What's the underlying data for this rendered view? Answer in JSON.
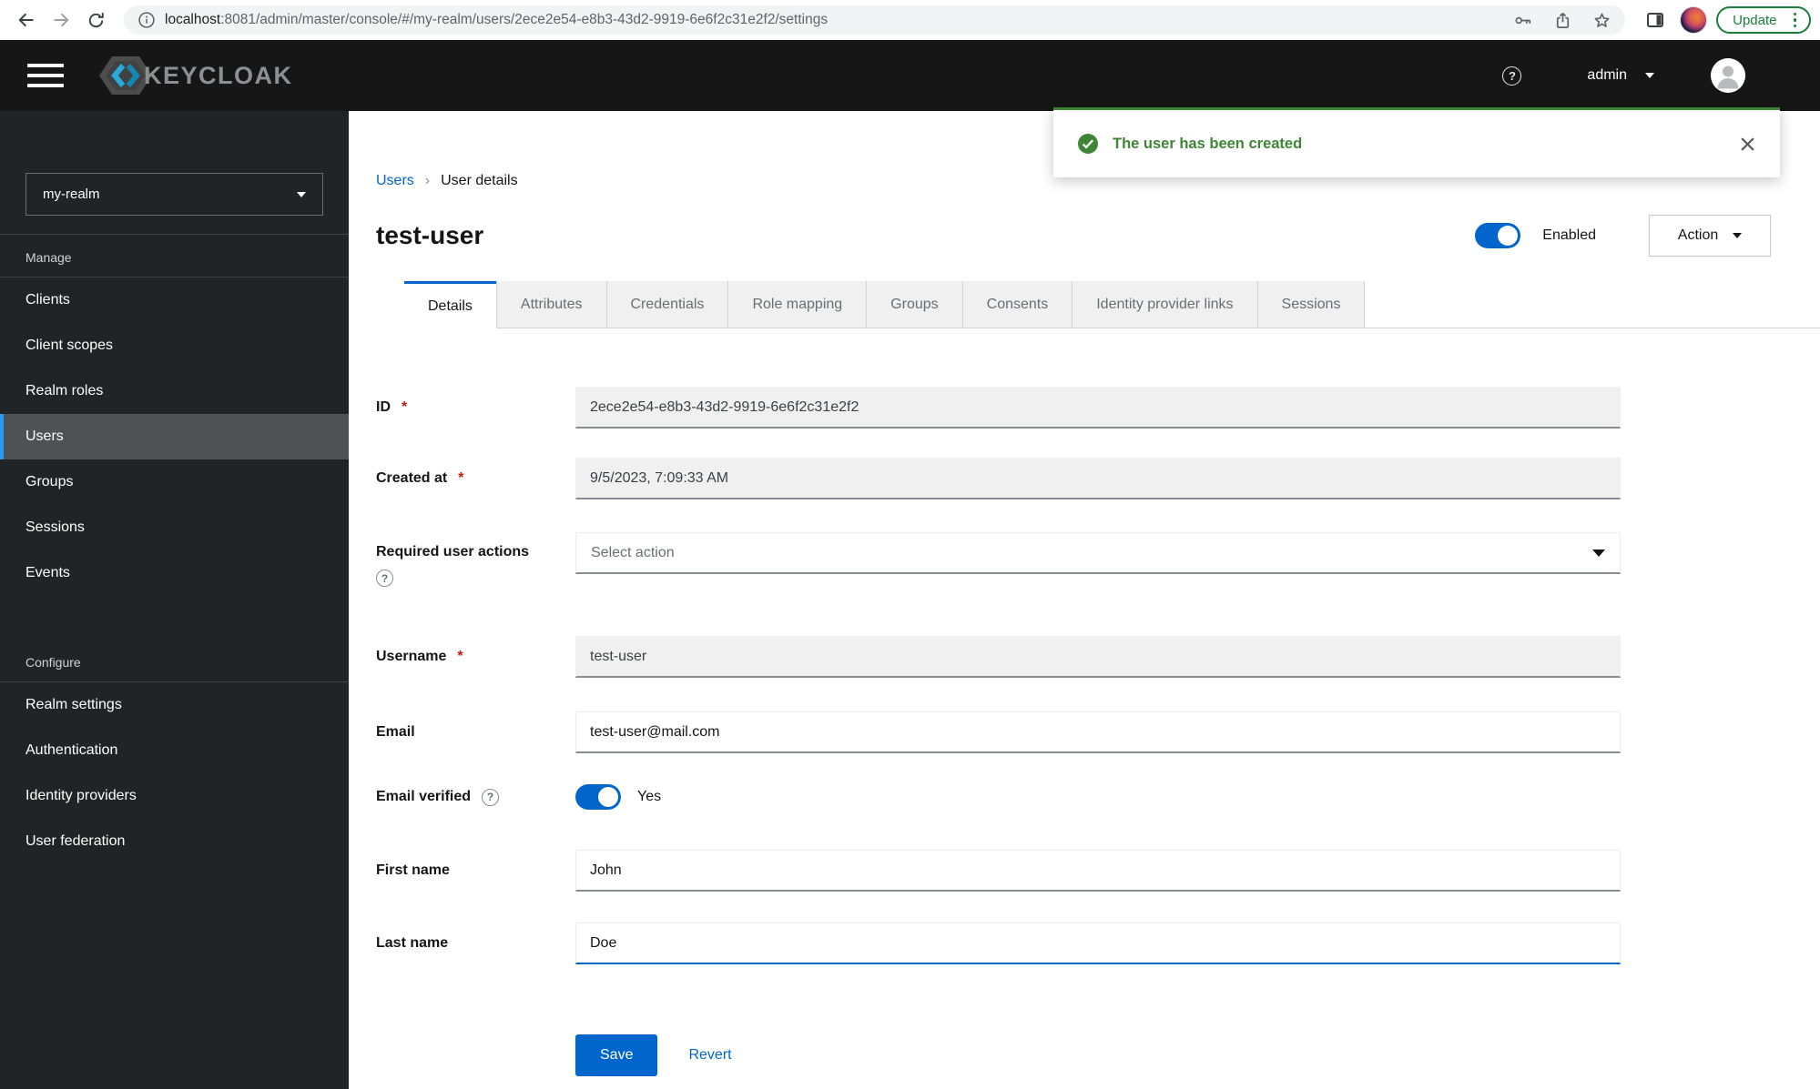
{
  "browser": {
    "url": {
      "host": "localhost",
      "path": ":8081/admin/master/console/#/my-realm/users/2ece2e54-e8b3-43d2-9919-6e6f2c31e2f2/settings"
    },
    "update_button": "Update"
  },
  "header": {
    "brand": "KEYCLOAK",
    "user_menu": "admin"
  },
  "toast": {
    "message": "The user has been created"
  },
  "sidebar": {
    "realm_selector": "my-realm",
    "sections": [
      {
        "label": "Manage",
        "items": [
          {
            "label": "Clients"
          },
          {
            "label": "Client scopes"
          },
          {
            "label": "Realm roles"
          },
          {
            "label": "Users"
          },
          {
            "label": "Groups"
          },
          {
            "label": "Sessions"
          },
          {
            "label": "Events"
          }
        ]
      },
      {
        "label": "Configure",
        "items": [
          {
            "label": "Realm settings"
          },
          {
            "label": "Authentication"
          },
          {
            "label": "Identity providers"
          },
          {
            "label": "User federation"
          }
        ]
      }
    ]
  },
  "breadcrumb": {
    "parent": "Users",
    "separator": "›",
    "current": "User details"
  },
  "page": {
    "title": "test-user",
    "enabled_label": "Enabled",
    "action_button": "Action"
  },
  "tabs": {
    "items": [
      {
        "label": "Details"
      },
      {
        "label": "Attributes"
      },
      {
        "label": "Credentials"
      },
      {
        "label": "Role mapping"
      },
      {
        "label": "Groups"
      },
      {
        "label": "Consents"
      },
      {
        "label": "Identity provider links"
      },
      {
        "label": "Sessions"
      }
    ]
  },
  "form": {
    "required_marker": "*",
    "help_glyph": "?",
    "id": {
      "label": "ID",
      "value": "2ece2e54-e8b3-43d2-9919-6e6f2c31e2f2"
    },
    "created_at": {
      "label": "Created at",
      "value": "9/5/2023, 7:09:33 AM"
    },
    "required_user_actions": {
      "label": "Required user actions",
      "placeholder": "Select action"
    },
    "username": {
      "label": "Username",
      "value": "test-user"
    },
    "email": {
      "label": "Email",
      "value": "test-user@mail.com"
    },
    "email_verified": {
      "label": "Email verified",
      "state": "Yes"
    },
    "first_name": {
      "label": "First name",
      "value": "John"
    },
    "last_name": {
      "label": "Last name",
      "value": "Doe"
    },
    "save_button": "Save",
    "revert_button": "Revert"
  },
  "colors": {
    "primary_blue": "#0066cc",
    "success_green": "#3e8635",
    "required_red": "#c9190b",
    "nav_active_indicator": "#2b9af3",
    "chrome_update_green": "#188038"
  }
}
